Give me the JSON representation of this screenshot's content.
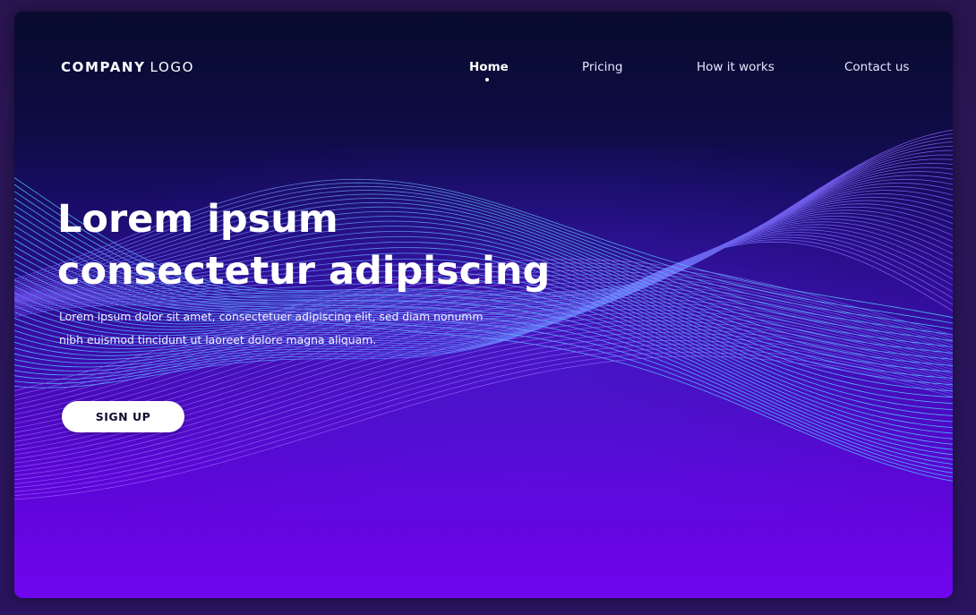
{
  "header": {
    "logo_bold": "COMPANY",
    "logo_light": "LOGO",
    "nav": [
      {
        "label": "Home",
        "active": true
      },
      {
        "label": "Pricing",
        "active": false
      },
      {
        "label": "How it works",
        "active": false
      },
      {
        "label": "Contact us",
        "active": false
      }
    ]
  },
  "hero": {
    "title_line1": "Lorem ipsum",
    "title_line2": "consectetur adipiscing",
    "description_line1": "Lorem ipsum dolor sit amet, consectetuer adipiscing elit, sed diam nonumm",
    "description_line2": "nibh euismod tincidunt ut laoreet dolore magna aliquam.",
    "cta_label": "SIGN UP"
  },
  "colors": {
    "background_top": "#070b2d",
    "background_bottom": "#7006ee",
    "wave_cyan": "#4fc8ff",
    "wave_violet": "#8a5bff",
    "button_bg": "#ffffff",
    "button_text": "#120d2e"
  }
}
